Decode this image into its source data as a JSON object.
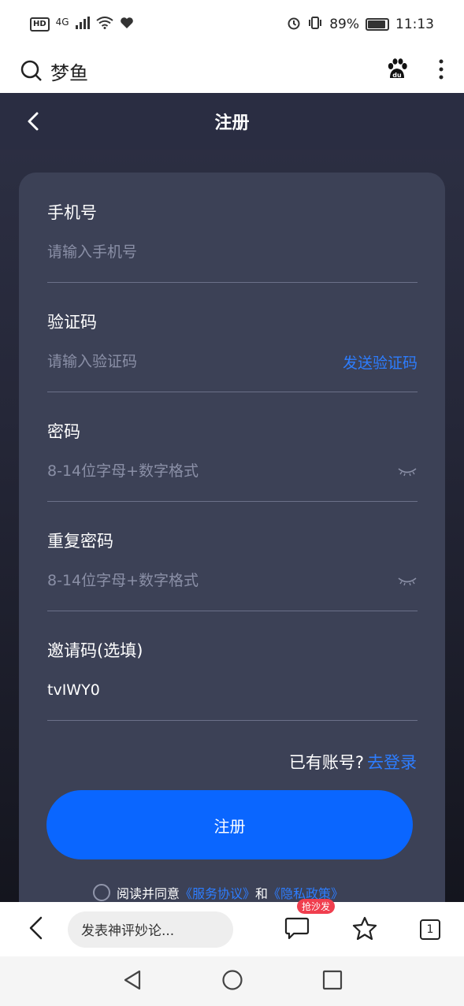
{
  "status_bar": {
    "hd": "HD",
    "network": "4G",
    "battery_percent": "89%",
    "time": "11:13"
  },
  "browser": {
    "search_text": "梦鱼",
    "logo_icon": "baidu-paw-icon",
    "menu_icon": "more-vertical-icon"
  },
  "app": {
    "title": "注册",
    "fields": {
      "phone": {
        "label": "手机号",
        "placeholder": "请输入手机号",
        "value": ""
      },
      "code": {
        "label": "验证码",
        "placeholder": "请输入验证码",
        "value": "",
        "action": "发送验证码"
      },
      "password": {
        "label": "密码",
        "placeholder": "8-14位字母+数字格式",
        "value": ""
      },
      "repeat_password": {
        "label": "重复密码",
        "placeholder": "8-14位字母+数字格式",
        "value": ""
      },
      "invite": {
        "label": "邀请码(选填)",
        "placeholder": "",
        "value": "tvIWY0"
      }
    },
    "has_account": "已有账号?",
    "login_link": "去登录",
    "register_button": "注册",
    "agree": {
      "prefix": "阅读并同意",
      "service": "《服务协议》",
      "and": "和",
      "privacy": "《隐私政策》"
    },
    "accent_color": "#2d7dff"
  },
  "bottom_bar": {
    "comment_placeholder": "发表神评妙论...",
    "sofa_badge": "抢沙发",
    "tab_count": "1"
  }
}
